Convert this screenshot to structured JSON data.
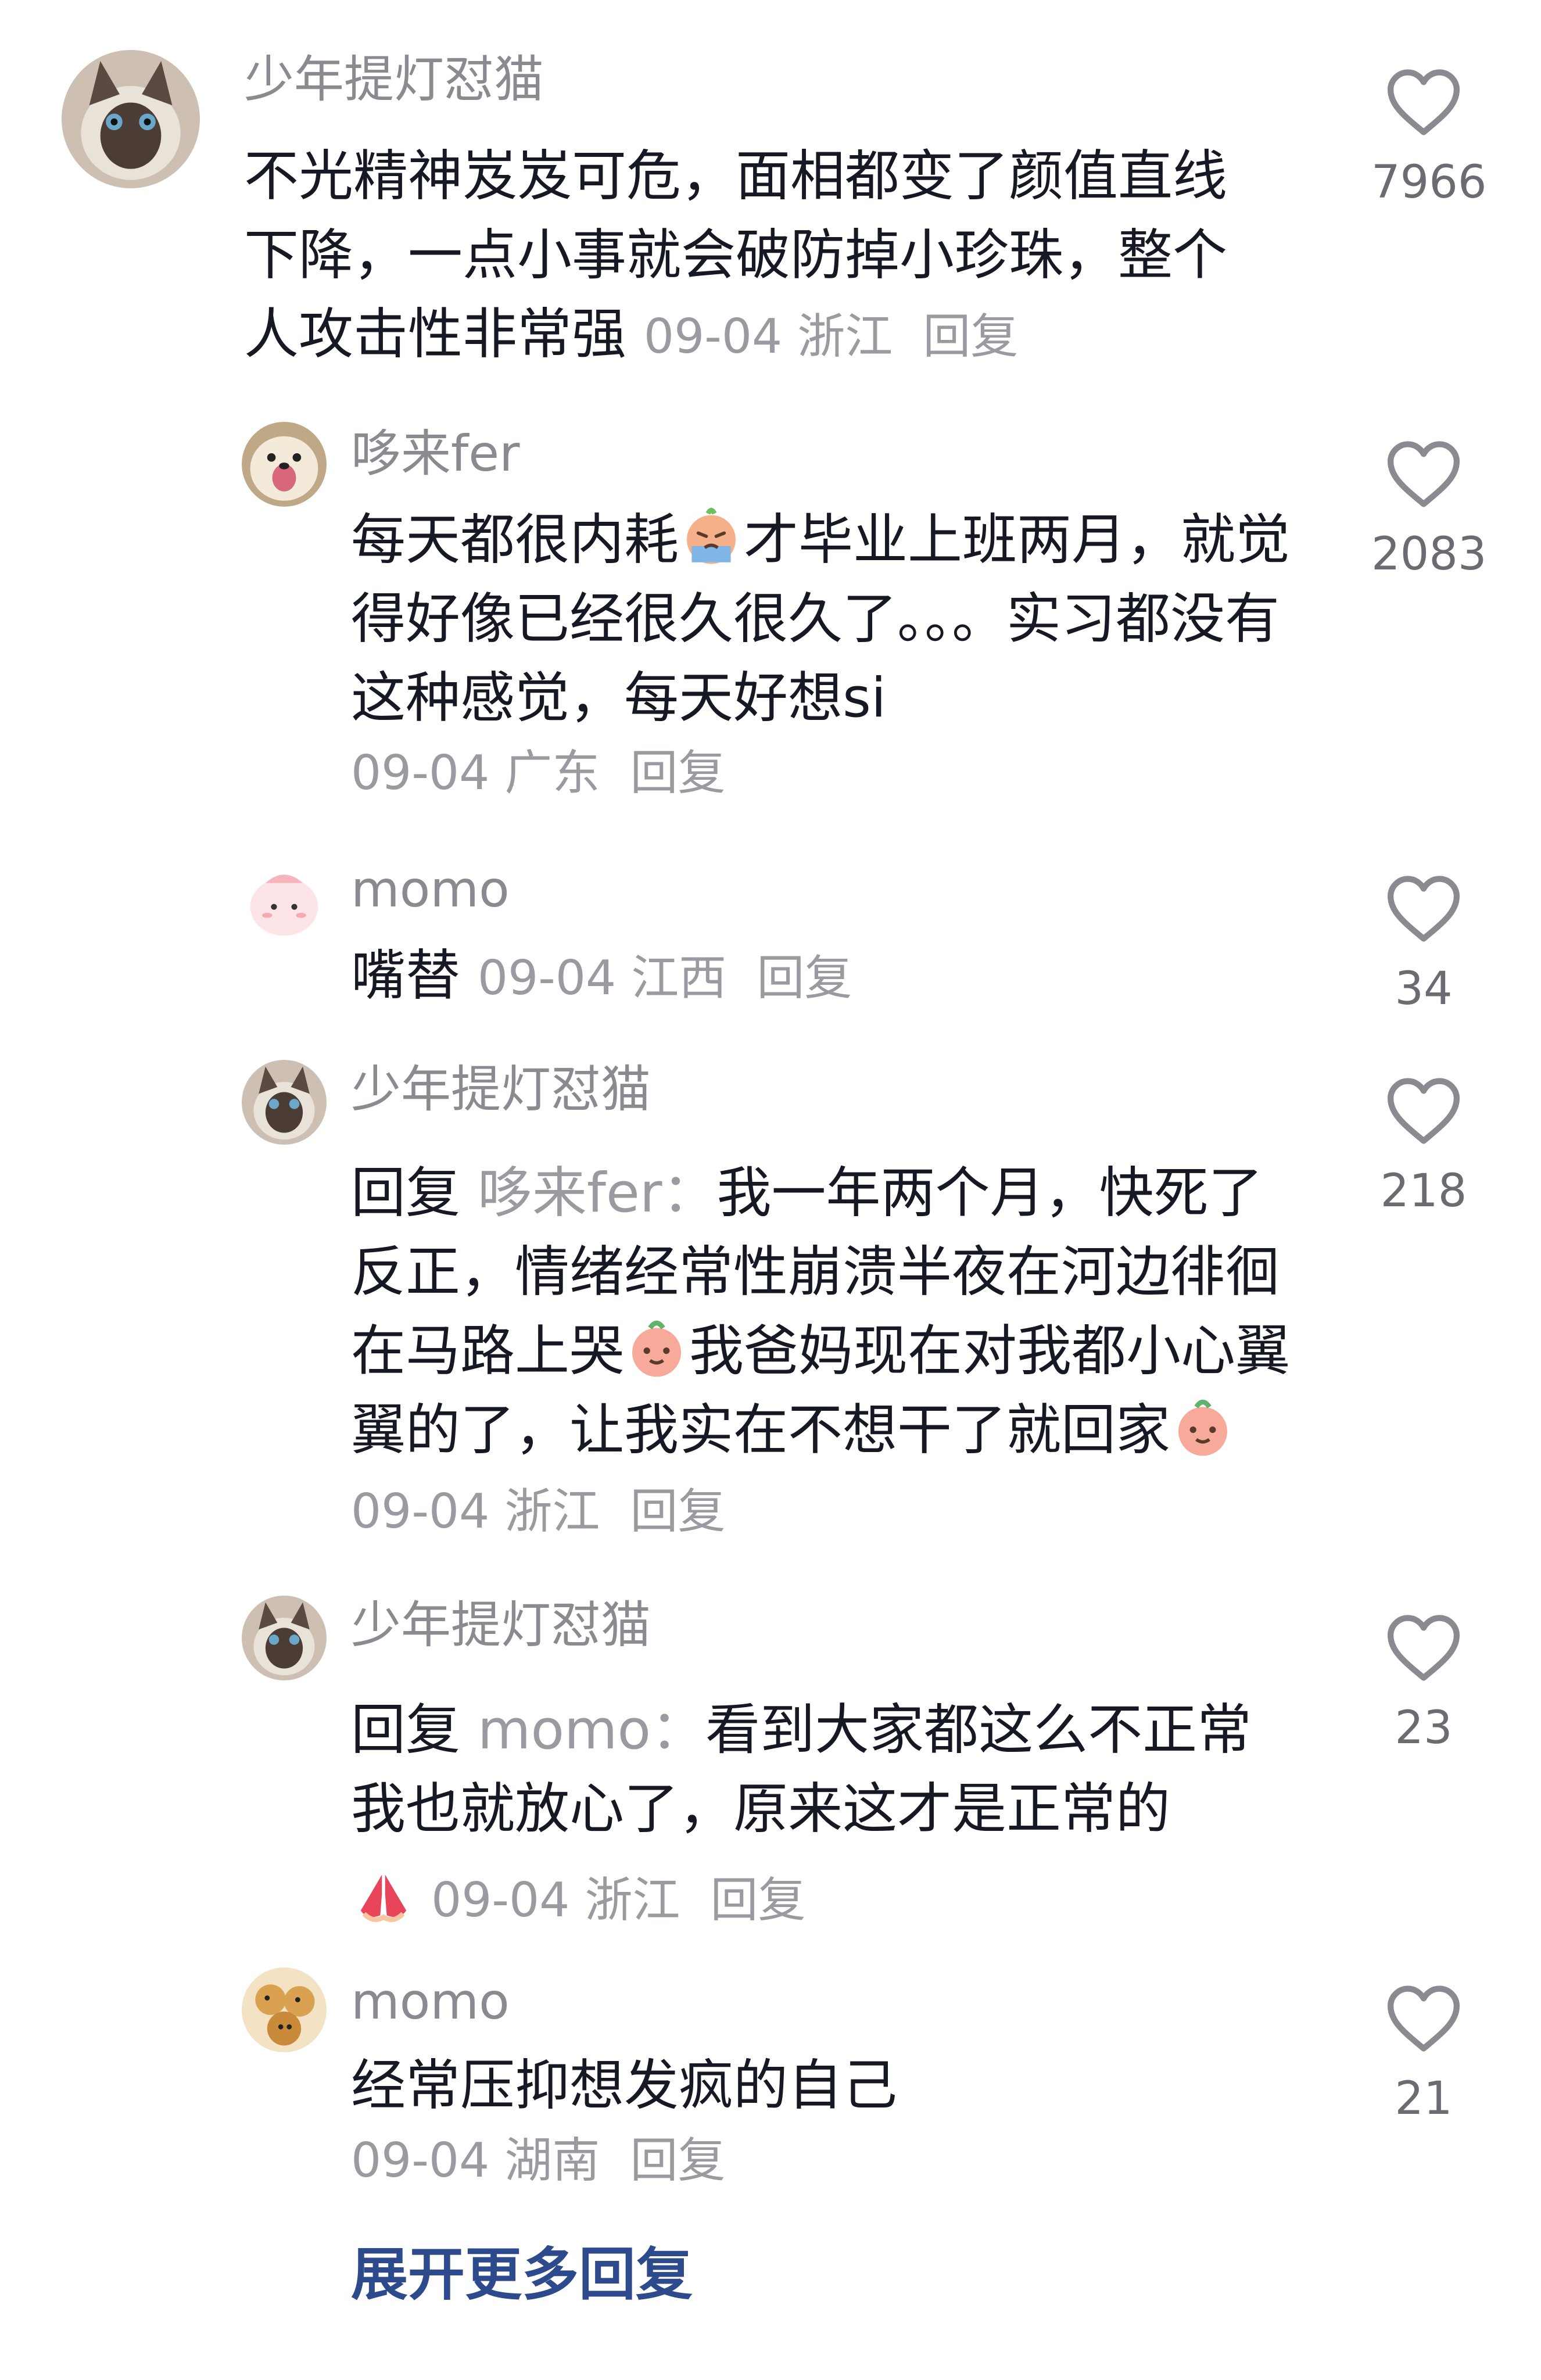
{
  "comments": [
    {
      "username": "少年提灯怼猫",
      "text": "不光精神岌岌可危，面相都变了颜值直线下降，一点小事就会破防掉小珍珠，整个人攻击性非常强",
      "date": "09-04",
      "location": "浙江",
      "reply_label": "回复",
      "likes": "7966"
    },
    {
      "username": "哆来fer",
      "text_a": "每天都很内耗",
      "text_b": "才毕业上班两月，就觉得好像已经很久很久了。。。实习都没有这种感觉，每天好想si",
      "date": "09-04",
      "location": "广东",
      "reply_label": "回复",
      "likes": "2083"
    },
    {
      "username": "momo",
      "text": "嘴替",
      "date": "09-04",
      "location": "江西",
      "reply_label": "回复",
      "likes": "34"
    },
    {
      "username": "少年提灯怼猫",
      "reply_prefix": "回复",
      "reply_target": "哆来fer：",
      "text_a": "我一年两个月，快死了反正，情绪经常性崩溃半夜在河边徘徊在马路上哭",
      "text_b": "我爸妈现在对我都小心翼翼的了，让我实在不想干了就回家",
      "date": "09-04",
      "location": "浙江",
      "reply_label": "回复",
      "likes": "218"
    },
    {
      "username": "少年提灯怼猫",
      "reply_prefix": "回复",
      "reply_target": "momo：",
      "text": "看到大家都这么不正常我也就放心了，原来这才是正常的",
      "date": "09-04",
      "location": "浙江",
      "reply_label": "回复",
      "likes": "23"
    },
    {
      "username": "momo",
      "text": "经常压抑想发疯的自己",
      "date": "09-04",
      "location": "湖南",
      "reply_label": "回复",
      "likes": "21"
    }
  ],
  "expand_more": "展开更多回复",
  "icons": {
    "like": "heart-outline-icon",
    "emoji_cry": "crying-emoji-icon",
    "emoji_peach": "peach-face-emoji-icon",
    "emoji_pray": "praying-hands-emoji-icon"
  },
  "colors": {
    "username": "#8a8b91",
    "text": "#161823",
    "meta": "#9a9ba1",
    "expand_link": "#2d4a8c"
  }
}
